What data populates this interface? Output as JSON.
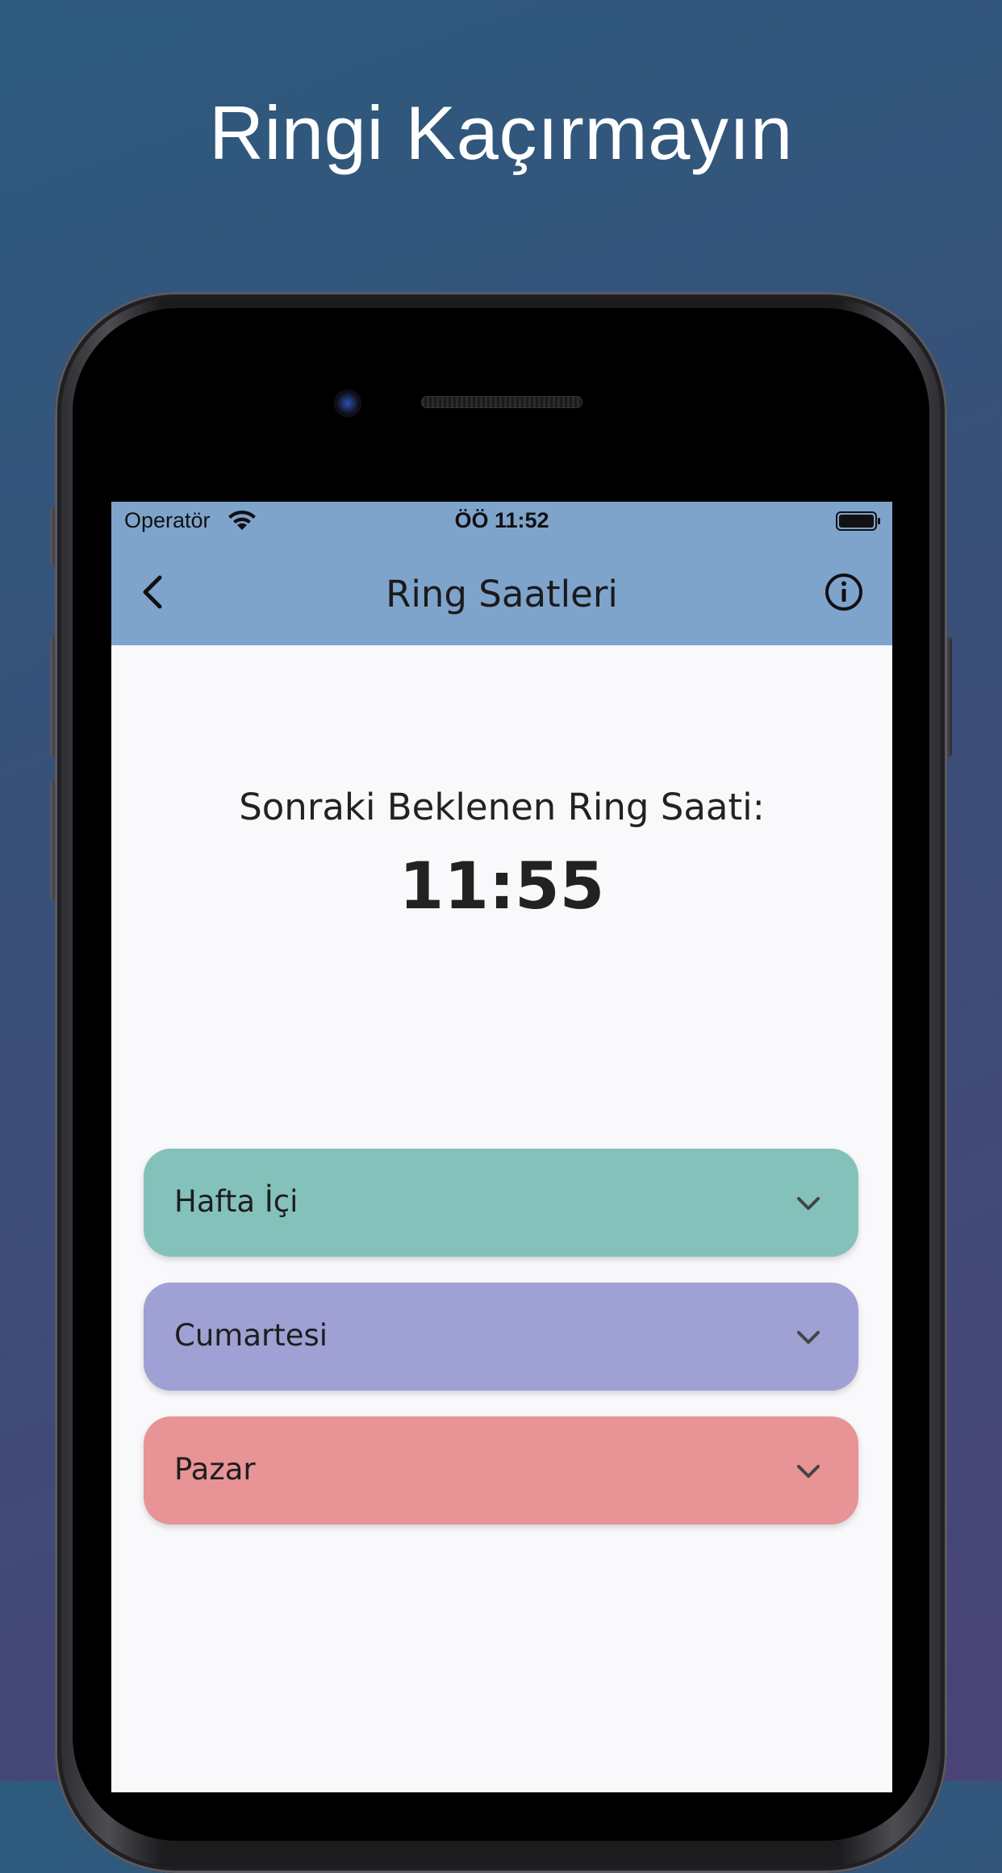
{
  "headline": "Ringi Kaçırmayın",
  "status_bar": {
    "carrier": "Operatör",
    "time": "ÖÖ 11:52"
  },
  "nav": {
    "title": "Ring Saatleri"
  },
  "next_ring": {
    "label": "Sonraki Beklenen Ring Saati:",
    "time": "11:55"
  },
  "schedules": [
    {
      "label": "Hafta İçi",
      "color": "#84c1bb"
    },
    {
      "label": "Cumartesi",
      "color": "#9fa0d3"
    },
    {
      "label": "Pazar",
      "color": "#e89396"
    }
  ],
  "colors": {
    "header": "#7fa4cc",
    "screen": "#f9f9fb"
  }
}
